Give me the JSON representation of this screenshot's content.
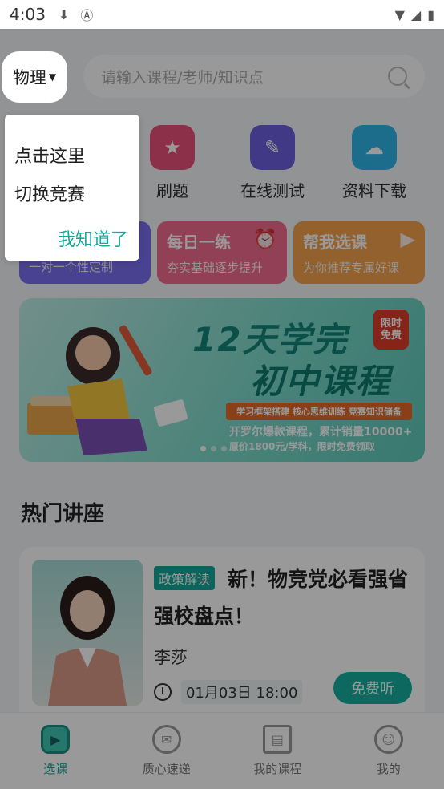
{
  "status": {
    "time": "4:03",
    "left_icons": [
      "download-icon",
      "a-icon"
    ],
    "right_icons": [
      "wifi-icon",
      "signal-icon",
      "battery-icon"
    ]
  },
  "header": {
    "subject": "物理",
    "search_placeholder": "请输入课程/老师/知识点"
  },
  "quick_nav": [
    {
      "label": "刷题",
      "icon": "medal-icon",
      "color": "#e9517a"
    },
    {
      "label": "在线测试",
      "icon": "quiz-doc-icon",
      "color": "#6f5fe0"
    },
    {
      "label": "资料下载",
      "icon": "cloud-download-icon",
      "color": "#2fb6e8"
    }
  ],
  "cards": [
    {
      "title": "",
      "subtitle": "一对一个性定制",
      "color": "#7b6ff0"
    },
    {
      "title": "每日一练",
      "subtitle": "夯实基础逐步提升",
      "color": "#f26b8e"
    },
    {
      "title": "帮我选课",
      "subtitle": "为你推荐专属好课",
      "color": "#f5a24b"
    }
  ],
  "banner": {
    "title1": "12天学完",
    "title2": "初中课程",
    "badge_line1": "限时",
    "badge_line2": "免费",
    "strip": "学习框架搭建 核心思维训练 竞赛知识储备",
    "line1": "开罗尔爆款课程，累计销量10000+",
    "line2": "原价1800元/学科，限时免费领取",
    "slide_count": 4,
    "active_slide": 0
  },
  "section": {
    "title": "热门讲座"
  },
  "lecture": {
    "tag": "政策解读",
    "title": "新！物竞党必看强省强校盘点！",
    "teacher": "李莎",
    "time": "01月03日 18:00",
    "button": "免费听"
  },
  "tabs": [
    {
      "label": "选课",
      "icon": "play-course-icon",
      "active": true
    },
    {
      "label": "质心速递",
      "icon": "chat-bubble-icon",
      "active": false
    },
    {
      "label": "我的课程",
      "icon": "book-icon",
      "active": false
    },
    {
      "label": "我的",
      "icon": "user-icon",
      "active": false
    }
  ],
  "tooltip": {
    "line1": "点击这里",
    "line2": "切换竞赛",
    "confirm": "我知道了"
  },
  "colors": {
    "accent": "#14a89a",
    "overlay": "rgba(0,0,0,0.40)"
  }
}
